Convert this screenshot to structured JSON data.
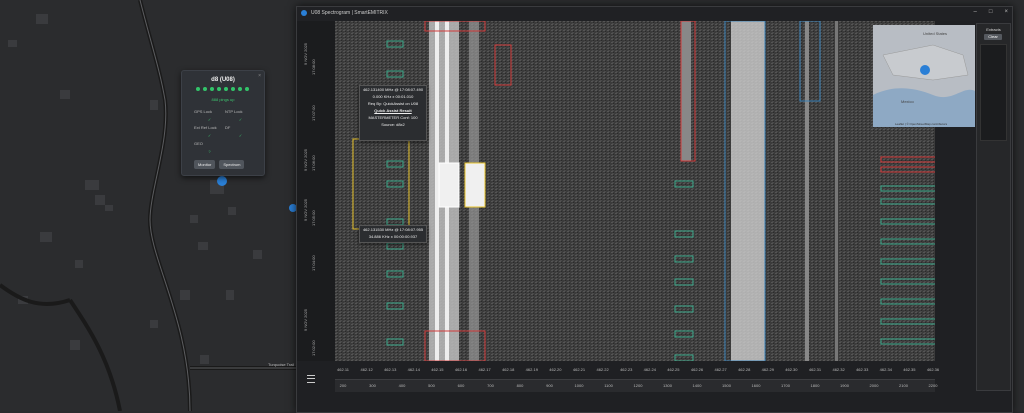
{
  "node_card": {
    "title": "d8 (U08)",
    "close": "×",
    "uptime": "888 pings up",
    "status": [
      {
        "label": "GPS Lock",
        "ok": "✓"
      },
      {
        "label": "NTP Lock",
        "ok": "✓"
      },
      {
        "label": "Ext Ref Lock",
        "ok": "✓"
      },
      {
        "label": "DF",
        "ok": "✓"
      },
      {
        "label": "GEO",
        "ok": "?"
      }
    ],
    "buttons": [
      "Monitor",
      "Spectrum"
    ]
  },
  "map_labels": {
    "road_1": "Turquoise Trail"
  },
  "window": {
    "title": "U08 Spectrogram | SmartEMITRIX",
    "controls": [
      "–",
      "□",
      "×"
    ]
  },
  "time_labels": [
    "9 NOV 2025",
    "17:08:00",
    "17:07:00",
    "17:06:00",
    "17:05:00",
    "9 NOV 2025",
    "17:06:00",
    "17:04:00",
    "17:03:00",
    "9 NOV 2025",
    "17:02:00"
  ],
  "popup_top": {
    "line1": "462.131400 MHz @ 17:08:07.490",
    "line2": "0.000 KHz x 00:01.010",
    "line3": "Req By: QuickAssist on U08",
    "link": "Quick Assist Result",
    "line5": "MASTERMETER Conf: 100",
    "line6": "Source: d8x2"
  },
  "popup_bottom": {
    "line1": "462.131530 MHz @ 17:08:07.955",
    "line2": "34.886 KHz x 00:00:00.937"
  },
  "freq_ticks": [
    "462.11",
    "462.12",
    "462.13",
    "462.14",
    "462.15",
    "462.16",
    "462.17",
    "462.18",
    "462.19",
    "462.20",
    "462.21",
    "462.22",
    "462.23",
    "462.24",
    "462.25",
    "462.26",
    "462.27",
    "462.28",
    "462.29",
    "462.30",
    "462.31",
    "462.32",
    "462.33",
    "462.34",
    "462.35",
    "462.36"
  ],
  "scale_ticks": [
    "200",
    "300",
    "400",
    "500",
    "600",
    "700",
    "800",
    "900",
    "1000",
    "1100",
    "1200",
    "1300",
    "1400",
    "1500",
    "1600",
    "1700",
    "1800",
    "1900",
    "2000",
    "2100",
    "2200"
  ],
  "extracts": {
    "header": "Extracts",
    "clear": "Clear"
  },
  "minimap": {
    "country": "United States",
    "mexico": "Mexico",
    "attribution": "Leaflet | © OpenStreetMap contributors"
  },
  "colors": {
    "accent_green": "#32c46a",
    "marker_blue": "#2a7fd6",
    "box_red": "#d23a3a",
    "box_teal": "#3aa88a",
    "box_blue": "#3a82b8",
    "box_yellow": "#e8c32a"
  }
}
